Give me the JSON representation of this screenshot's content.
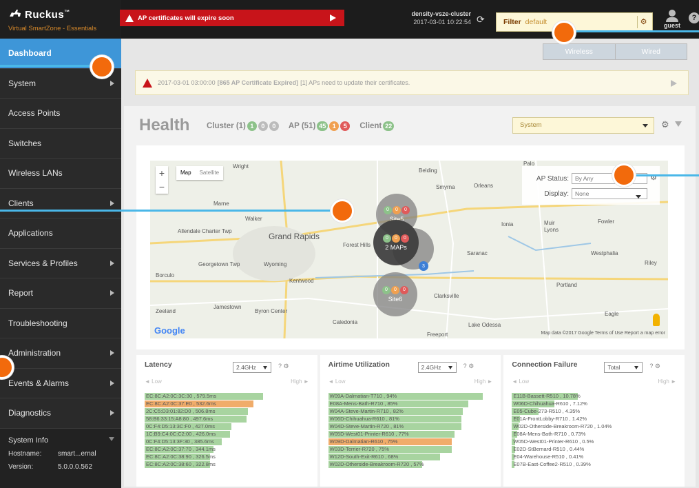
{
  "brand": {
    "name": "Ruckus",
    "tm": "™",
    "product": "Virtual SmartZone - Essentials"
  },
  "alert": {
    "text": "AP certificates will expire soon"
  },
  "cluster": {
    "name": "density-vsze-cluster",
    "datetime": "2017-03-01  10:22:54"
  },
  "filter": {
    "label": "Filter",
    "value": "default"
  },
  "user": {
    "name": "guest"
  },
  "sidebar": {
    "items": [
      {
        "label": "Dashboard",
        "active": true,
        "arrow": false
      },
      {
        "label": "System",
        "arrow": true
      },
      {
        "label": "Access Points",
        "arrow": false
      },
      {
        "label": "Switches",
        "arrow": false
      },
      {
        "label": "Wireless LANs",
        "arrow": false
      },
      {
        "label": "Clients",
        "arrow": true
      },
      {
        "label": "Applications",
        "arrow": false
      },
      {
        "label": "Services & Profiles",
        "arrow": true
      },
      {
        "label": "Report",
        "arrow": true
      },
      {
        "label": "Troubleshooting",
        "arrow": false
      },
      {
        "label": "Administration",
        "arrow": true
      },
      {
        "label": "Events & Alarms",
        "arrow": true
      },
      {
        "label": "Diagnostics",
        "arrow": true
      }
    ],
    "sysinfo": {
      "title": "System Info",
      "hostname_label": "Hostname:",
      "hostname": "smart...ernal",
      "version_label": "Version:",
      "version": "5.0.0.0.562"
    }
  },
  "subtabs": [
    "Wireless",
    "Wired"
  ],
  "notice": {
    "time": "2017-03-01 03:00:00",
    "bold": "[865 AP Certificate Expired]",
    "rest": "[1] APs need to update their certificates."
  },
  "health": {
    "title": "Health",
    "cluster_label": "Cluster (1)",
    "cluster_counts": [
      "1",
      "0",
      "0"
    ],
    "ap_label": "AP (51)",
    "ap_counts": [
      "45",
      "1",
      "5"
    ],
    "client_label": "Client",
    "client_count": "22",
    "system_select": "System"
  },
  "map": {
    "type_map": "Map",
    "type_satellite": "Satellite",
    "ap_status_label": "AP Status:",
    "ap_status_value": "By Any",
    "display_label": "Display:",
    "display_value": "None",
    "places": [
      "Wright",
      "Belding",
      "Smyrna",
      "Orleans",
      "Marne",
      "Walker",
      "Ionia",
      "Muir",
      "Lyons",
      "Fowler",
      "Allendale Charter Twp",
      "Grand Rapids",
      "Forest Hills",
      "Saranac",
      "Westphalia",
      "Georgetown Twp",
      "Wyoming",
      "Riley",
      "Borculo",
      "Kentwood",
      "Portland",
      "Jamestown",
      "Clarksville",
      "Zeeland",
      "Byron Center",
      "Caledonia",
      "Lake Odessa",
      "Eagle",
      "Freeport",
      "Palo"
    ],
    "sites": [
      {
        "label": "Site5",
        "counts": [
          "0",
          "0",
          "0"
        ]
      },
      {
        "label": "2 MAPs",
        "counts": [
          "0",
          "0",
          "0"
        ]
      },
      {
        "label": "Site6",
        "counts": [
          "0",
          "0",
          "0"
        ]
      }
    ],
    "cluster_badge": "3",
    "google": "Google",
    "copyright": "Map data ©2017 Google   Terms of Use   Report a map error"
  },
  "latency": {
    "title": "Latency",
    "band": "2.4GHz",
    "low": "◄ Low",
    "high": "High ►",
    "rows": [
      {
        "label": "EC:8C:A2:0C:3C:30 , 579.5ms",
        "pct": 0.72
      },
      {
        "label": "EC:8C:A2:0C:37:E0 , 532.6ms",
        "pct": 0.66,
        "warn": true
      },
      {
        "label": "2C:C5:D3:01:82:D0 , 506.8ms",
        "pct": 0.63
      },
      {
        "label": "58:B6:33:15:A8:80 , 497.6ms",
        "pct": 0.62
      },
      {
        "label": "0C:F4:D5:13:3C:F0 , 427.0ms",
        "pct": 0.53
      },
      {
        "label": "1C:B9:C4:0C:C2:00 , 426.0ms",
        "pct": 0.52
      },
      {
        "label": "0C:F4:D5:13:3F:30 , 385.6ms",
        "pct": 0.47
      },
      {
        "label": "EC:8C:A2:0C:37:70 , 344.1ms",
        "pct": 0.42
      },
      {
        "label": "EC:8C:A2:0C:38:90 , 326.5ms",
        "pct": 0.4
      },
      {
        "label": "EC:8C:A2:0C:38:60 , 322.8ms",
        "pct": 0.4
      }
    ]
  },
  "airtime": {
    "title": "Airtime Utilization",
    "band": "2.4GHz",
    "low": "◄ Low",
    "high": "High ►",
    "rows": [
      {
        "label": "W09A-Dalmatian-T710 , 94%",
        "pct": 0.94
      },
      {
        "label": "E08A-Mens-Bath-R710 , 85%",
        "pct": 0.85
      },
      {
        "label": "W04A-Steve-Martin-R710 , 82%",
        "pct": 0.82
      },
      {
        "label": "W06D-Chihuahua-R610 , 81%",
        "pct": 0.81
      },
      {
        "label": "W04D-Steve-Martin-R720 , 81%",
        "pct": 0.81
      },
      {
        "label": "W05D-West01-Printer-R610 , 77%",
        "pct": 0.77
      },
      {
        "label": "W09D-Dalmatian-R610 , 75%",
        "pct": 0.75,
        "warn": true
      },
      {
        "label": "W03D-Terrier-R720 , 75%",
        "pct": 0.75
      },
      {
        "label": "W12D-South-Exit-R610 , 68%",
        "pct": 0.68
      },
      {
        "label": "W02D-Otherside-Breakroom-R720 , 57%",
        "pct": 0.57
      }
    ]
  },
  "connfail": {
    "title": "Connection Failure",
    "band": "Total",
    "low": "◄ Low",
    "high": "High ►",
    "rows": [
      {
        "label": "E11B-Bassett-R510 , 10.78%",
        "pct": 0.4
      },
      {
        "label": "W06D-Chihuahua-R610 , 7.12%",
        "pct": 0.26
      },
      {
        "label": "E05-Cube-273-R510 , 4.35%",
        "pct": 0.16
      },
      {
        "label": "E01A-FrontLobby-R710 , 1.42%",
        "pct": 0.05
      },
      {
        "label": "W02D-Otherside-Breakroom-R720 , 1.04%",
        "pct": 0.04
      },
      {
        "label": "E08A-Mens-Bath-R710 , 0.73%",
        "pct": 0.03
      },
      {
        "label": "W05D-West01-Printer-R610 , 0.5%",
        "pct": 0.02
      },
      {
        "label": "E02D-StBernard-R510 , 0.44%",
        "pct": 0.02
      },
      {
        "label": "E04-Warehouse-R510 , 0.41%",
        "pct": 0.015
      },
      {
        "label": "E07B-East-Coffee2-R510 , 0.39%",
        "pct": 0.014
      }
    ]
  }
}
